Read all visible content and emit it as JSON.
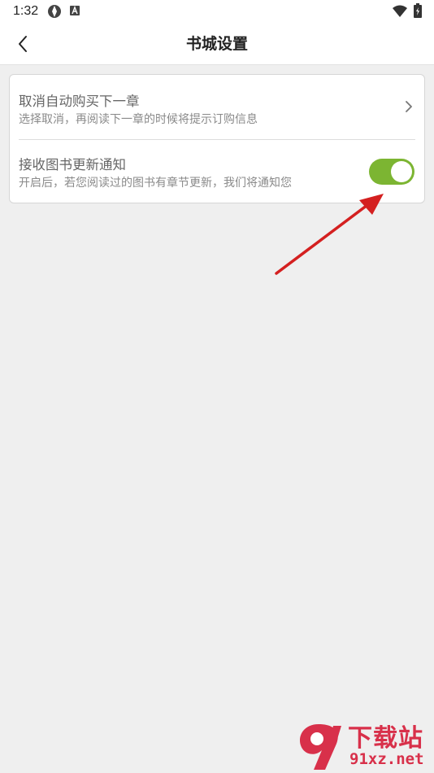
{
  "status_bar": {
    "time": "1:32",
    "icons": [
      "app-notification-icon",
      "text-notification-icon",
      "wifi-icon",
      "battery-icon"
    ]
  },
  "app_bar": {
    "back_icon": "chevron-left-icon",
    "title": "书城设置"
  },
  "settings": [
    {
      "title": "取消自动购买下一章",
      "description": "选择取消，再阅读下一章的时候将提示订购信息",
      "control": "chevron-right-icon"
    },
    {
      "title": "接收图书更新通知",
      "description": "开启后，若您阅读过的图书有章节更新，我们将通知您",
      "control": "toggle",
      "enabled": true
    }
  ],
  "colors": {
    "toggle_on": "#7cb532",
    "annotation_arrow": "#d42020",
    "background": "#efefef"
  },
  "watermark": {
    "brand": "下载站",
    "site": "91xz.net"
  }
}
